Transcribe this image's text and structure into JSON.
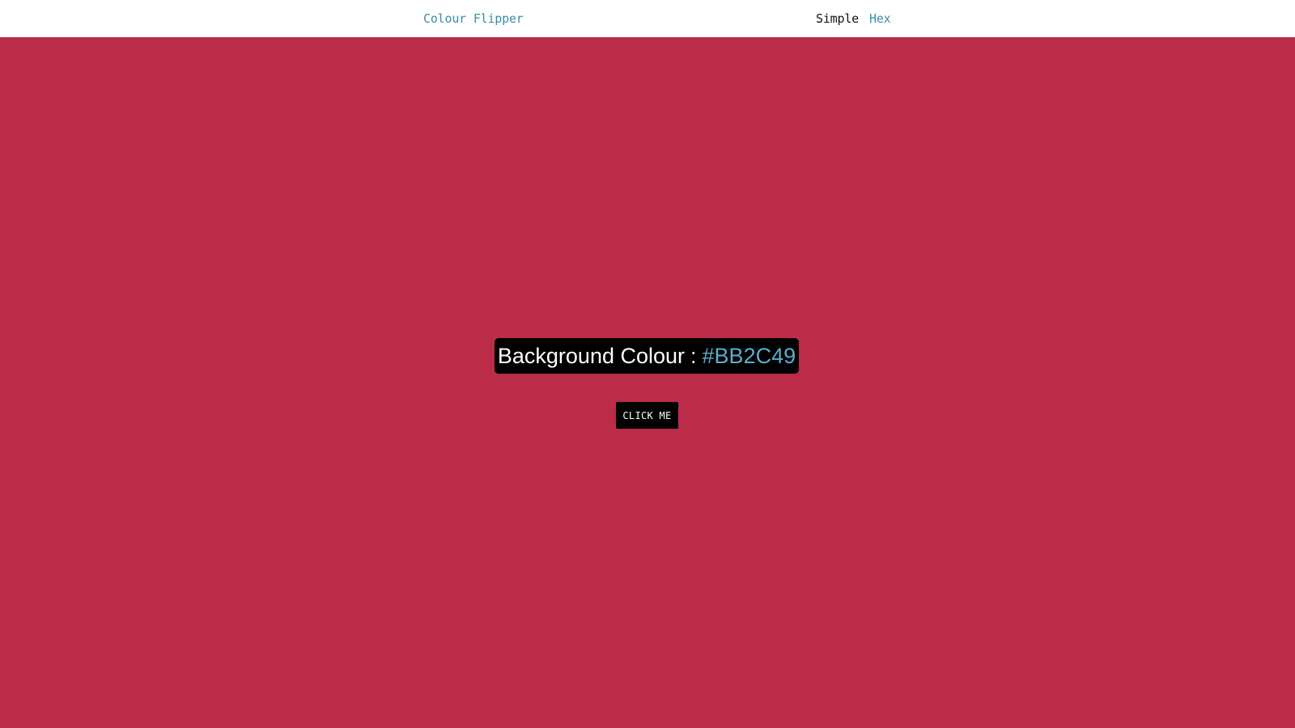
{
  "navbar": {
    "brand": "Colour Flipper",
    "links": [
      {
        "label": "Simple",
        "active": true
      },
      {
        "label": "Hex",
        "active": false
      }
    ]
  },
  "main": {
    "background_label": "Background Colour",
    "separator": ":",
    "background_value": "#BB2C49",
    "button_label": "CLICK ME"
  },
  "colors": {
    "page_background": "#BB2C49",
    "navbar_background": "#FFFFFF",
    "link_accent": "#3A8FA6",
    "value_accent": "#5AAECC",
    "box_background": "#000000"
  }
}
